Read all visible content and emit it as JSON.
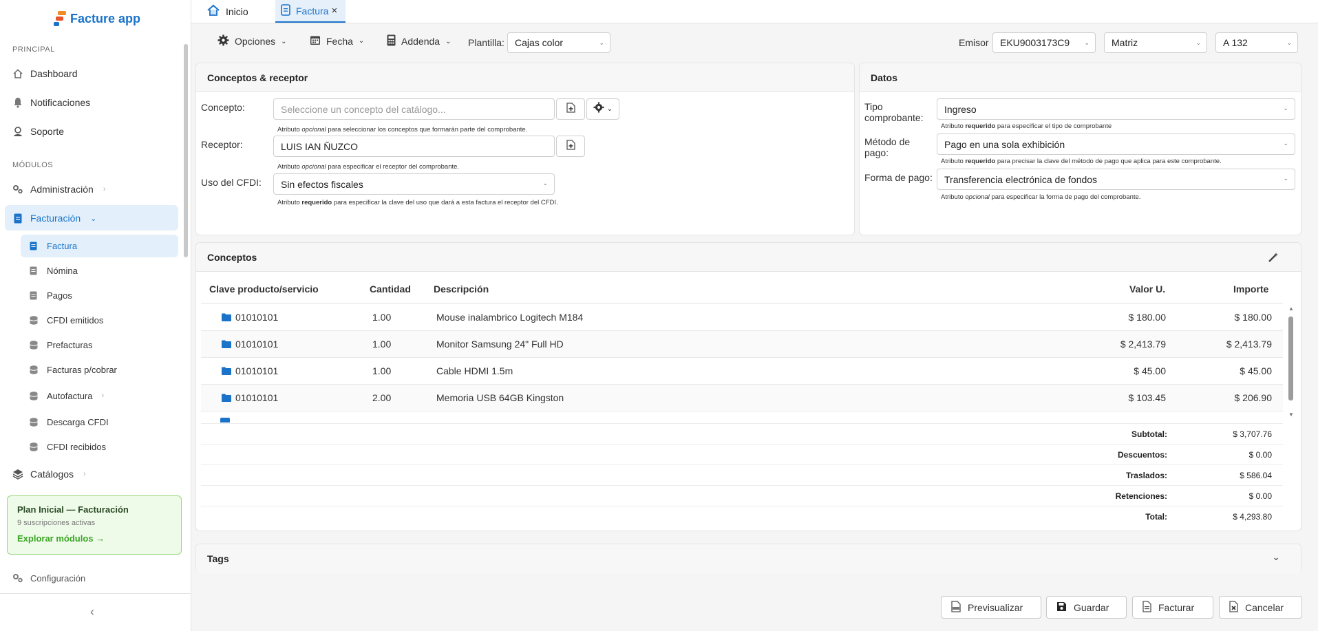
{
  "app": {
    "name": "Facture app"
  },
  "sidebar": {
    "principal_label": "PRINCIPAL",
    "principal_items": [
      {
        "label": "Dashboard",
        "icon": "home-icon"
      },
      {
        "label": "Notificaciones",
        "icon": "bell-icon"
      },
      {
        "label": "Soporte",
        "icon": "support-icon"
      }
    ],
    "modulos_label": "MÓDULOS",
    "administracion": "Administración",
    "facturacion": "Facturación",
    "facturacion_sub": [
      "Factura",
      "Nómina",
      "Pagos",
      "CFDI emitidos",
      "Prefacturas",
      "Facturas p/cobrar",
      "Autofactura",
      "Descarga CFDI",
      "CFDI recibidos"
    ],
    "catalogos": "Catálogos",
    "plan": {
      "title": "Plan Inicial — Facturación",
      "subtitle": "9 suscripciones activas",
      "link": "Explorar módulos →"
    },
    "configuracion": "Configuración"
  },
  "tabs": [
    {
      "label": "Inicio"
    },
    {
      "label": "Factura",
      "close": "×"
    }
  ],
  "toolbar": {
    "opciones": "Opciones",
    "fecha": "Fecha",
    "addenda": "Addenda",
    "plantilla_label": "Plantilla:",
    "plantilla_value": "Cajas color",
    "emisor_label": "Emisor",
    "emisor_value": "EKU9003173C9",
    "sucursal_value": "Matriz",
    "serie_value": "A 132"
  },
  "conceptos_receptor": {
    "title": "Conceptos & receptor",
    "concepto_label": "Concepto:",
    "concepto_placeholder": "Seleccione un concepto del catálogo...",
    "concepto_help_pre": "Atributo",
    "concepto_help_em": "opcional",
    "concepto_help_post": "para seleccionar los conceptos que formarán parte del comprobante.",
    "receptor_label": "Receptor:",
    "receptor_value": "LUIS IAN ÑUZCO",
    "receptor_help_pre": "Atributo",
    "receptor_help_em": "opcional",
    "receptor_help_post": "para especificar el receptor del comprobante.",
    "uso_label": "Uso del CFDI:",
    "uso_value": "Sin efectos fiscales",
    "uso_help_pre": "Atributo",
    "uso_help_em": "requerido",
    "uso_help_post": "para especificar la clave del uso que dará a esta factura el receptor del CFDI."
  },
  "datos": {
    "title": "Datos",
    "tipo_label_1": "Tipo",
    "tipo_label_2": "comprobante:",
    "tipo_value": "Ingreso",
    "tipo_help_pre": "Atributo",
    "tipo_help_em": "requerido",
    "tipo_help_post": "para especificar el tipo de comprobante",
    "metodo_label_1": "Método de",
    "metodo_label_2": "pago:",
    "metodo_value": "Pago en una sola exhibición",
    "metodo_help_pre": "Atributo",
    "metodo_help_em": "requerido",
    "metodo_help_post": "para precisar la clave del método de pago que aplica para este comprobante.",
    "forma_label": "Forma de pago:",
    "forma_value": "Transferencia electrónica de fondos",
    "forma_help_pre": "Atributo",
    "forma_help_em": "opcional",
    "forma_help_post": "para especificar la forma de pago del comprobante."
  },
  "conceptos": {
    "title": "Conceptos",
    "headers": {
      "clave": "Clave producto/servicio",
      "cantidad": "Cantidad",
      "descripcion": "Descripción",
      "valor": "Valor U.",
      "importe": "Importe"
    },
    "rows": [
      {
        "clave": "01010101",
        "cantidad": "1.00",
        "descripcion": "Mouse inalambrico Logitech M184",
        "valor": "$ 180.00",
        "importe": "$ 180.00"
      },
      {
        "clave": "01010101",
        "cantidad": "1.00",
        "descripcion": "Monitor Samsung 24\" Full HD",
        "valor": "$ 2,413.79",
        "importe": "$ 2,413.79"
      },
      {
        "clave": "01010101",
        "cantidad": "1.00",
        "descripcion": "Cable HDMI 1.5m",
        "valor": "$ 45.00",
        "importe": "$ 45.00"
      },
      {
        "clave": "01010101",
        "cantidad": "2.00",
        "descripcion": "Memoria USB 64GB Kingston",
        "valor": "$ 103.45",
        "importe": "$ 206.90"
      }
    ],
    "totals": [
      {
        "label": "Subtotal:",
        "value": "$ 3,707.76"
      },
      {
        "label": "Descuentos:",
        "value": "$ 0.00"
      },
      {
        "label": "Traslados:",
        "value": "$ 586.04"
      },
      {
        "label": "Retenciones:",
        "value": "$ 0.00"
      },
      {
        "label": "Total:",
        "value": "$ 4,293.80"
      }
    ]
  },
  "tags": {
    "title": "Tags"
  },
  "actions": {
    "previsualizar": "Previsualizar",
    "guardar": "Guardar",
    "facturar": "Facturar",
    "cancelar": "Cancelar"
  },
  "colors": {
    "accent": "#1a73c9",
    "active_bg": "#e3f0fc",
    "plan_bg": "#eefbe9",
    "plan_link": "#3aa524"
  }
}
